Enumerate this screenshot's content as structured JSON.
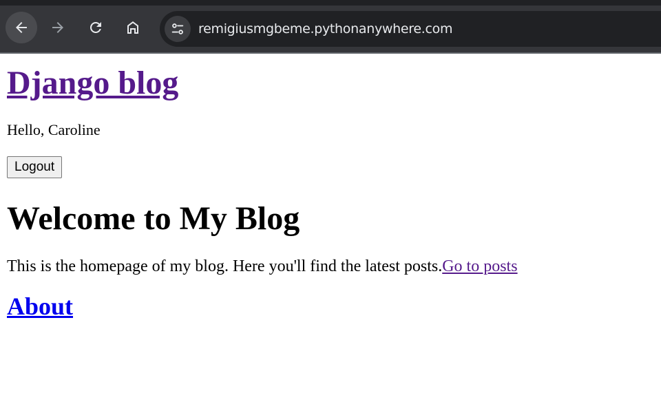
{
  "browser": {
    "url": "remigiusmgbeme.pythonanywhere.com",
    "icons": {
      "back": "arrow-left-icon",
      "forward": "arrow-right-icon",
      "reload": "reload-icon",
      "home": "home-icon",
      "site_info": "tune-icon"
    },
    "colors": {
      "toolbar_bg": "#35363a",
      "omnibox_bg": "#202124",
      "icon": "#e8eaed",
      "icon_disabled": "#9aa0a6"
    }
  },
  "page": {
    "site_title": "Django blog",
    "greeting": "Hello, Caroline",
    "logout_label": "Logout",
    "welcome_heading": "Welcome to My Blog",
    "intro_text": "This is the homepage of my blog. Here you'll find the latest posts.",
    "posts_link": "Go to posts",
    "about_link": "About",
    "colors": {
      "visited_link": "#551a8b",
      "link": "#0000ee",
      "text": "#000000"
    }
  }
}
